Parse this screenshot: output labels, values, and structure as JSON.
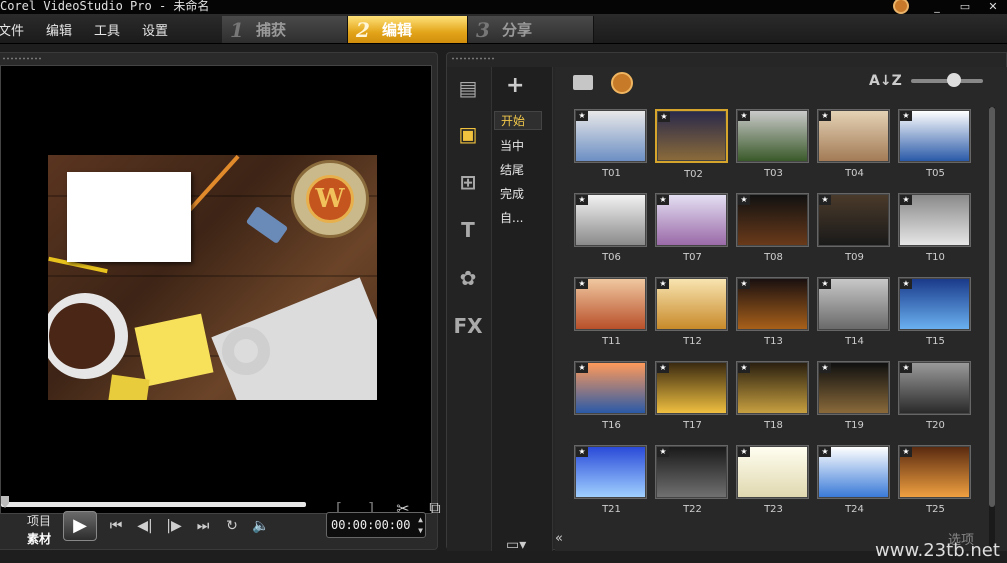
{
  "window": {
    "title": "Corel VideoStudio Pro - 未命名",
    "controls": [
      "_",
      "▭",
      "✕"
    ]
  },
  "menu": [
    "文件",
    "编辑",
    "工具",
    "设置"
  ],
  "steps": [
    {
      "num": "1",
      "label": "捕获",
      "active": false
    },
    {
      "num": "2",
      "label": "编辑",
      "active": true
    },
    {
      "num": "3",
      "label": "分享",
      "active": false
    }
  ],
  "player": {
    "mode_labels": [
      "项目",
      "素材"
    ],
    "timecode": "00:00:00:00",
    "play_icon": "▶",
    "transport": [
      "⏮",
      "◀|",
      "|▶",
      "⏭",
      "↻",
      "🔈"
    ]
  },
  "library": {
    "folders": [
      "开始",
      "当中",
      "结尾",
      "完成",
      "自..."
    ],
    "active_folder": "开始",
    "thumbnails": [
      "T01",
      "T02",
      "T03",
      "T04",
      "T05",
      "T06",
      "T07",
      "T08",
      "T09",
      "T10",
      "T11",
      "T12",
      "T13",
      "T14",
      "T15",
      "T16",
      "T17",
      "T18",
      "T19",
      "T20",
      "T21",
      "T22",
      "T23",
      "T24",
      "T25"
    ],
    "selected": "T02",
    "side_tabs": [
      "media",
      "instant-project",
      "transition",
      "title",
      "graphic",
      "FX"
    ],
    "fx_label": "FX"
  },
  "options_label": "选项",
  "watermark": "www.23tb.net"
}
